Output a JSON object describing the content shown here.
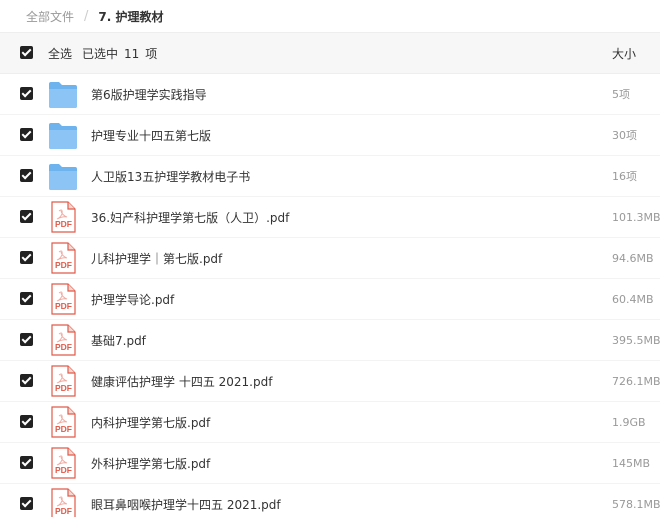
{
  "breadcrumb": {
    "root": "全部文件",
    "separator": "/",
    "current": "7. 护理教材"
  },
  "header": {
    "select_all_label": "全选",
    "selected_prefix": "已选中",
    "selected_count": "11",
    "selected_suffix": "项",
    "size_label": "大小"
  },
  "colors": {
    "folder": "#6fb3ee",
    "pdf_red": "#e25b4a",
    "checkbox": "#222222"
  },
  "files": [
    {
      "name": "第6版护理学实践指导",
      "size": "5项",
      "icon": "folder-icon"
    },
    {
      "name": "护理专业十四五第七版",
      "size": "30项",
      "icon": "folder-icon"
    },
    {
      "name": "人卫版13五护理学教材电子书",
      "size": "16项",
      "icon": "folder-icon"
    },
    {
      "name": "36.妇产科护理学第七版（人卫）.pdf",
      "size": "101.3MB",
      "icon": "pdf-icon"
    },
    {
      "name": "儿科护理学｜第七版.pdf",
      "size": "94.6MB",
      "icon": "pdf-icon"
    },
    {
      "name": "护理学导论.pdf",
      "size": "60.4MB",
      "icon": "pdf-icon"
    },
    {
      "name": "基础7.pdf",
      "size": "395.5MB",
      "icon": "pdf-icon"
    },
    {
      "name": "健康评估护理学 十四五 2021.pdf",
      "size": "726.1MB",
      "icon": "pdf-icon"
    },
    {
      "name": "内科护理学第七版.pdf",
      "size": "1.9GB",
      "icon": "pdf-icon"
    },
    {
      "name": "外科护理学第七版.pdf",
      "size": "145MB",
      "icon": "pdf-icon"
    },
    {
      "name": "眼耳鼻咽喉护理学十四五 2021.pdf",
      "size": "578.1MB",
      "icon": "pdf-icon"
    }
  ],
  "pdf_icon_text": "PDF"
}
